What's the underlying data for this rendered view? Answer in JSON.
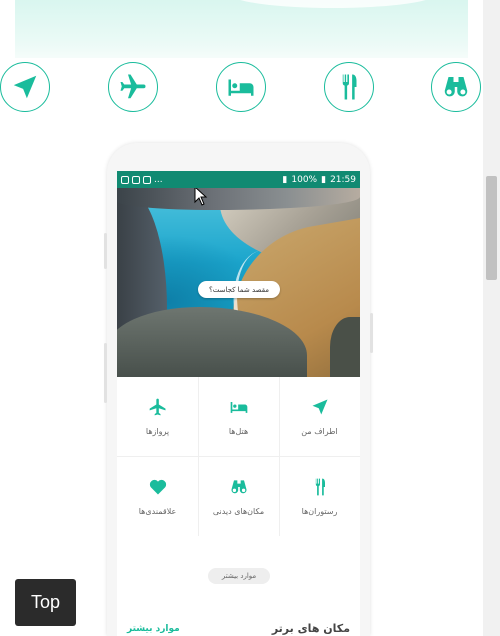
{
  "colors": {
    "accent": "#1abc9c",
    "status_bar": "#118a72",
    "top_button_bg": "#2b2b2b"
  },
  "icon_row": [
    {
      "icon": "location-arrow-icon"
    },
    {
      "icon": "airplane-icon"
    },
    {
      "icon": "bed-icon"
    },
    {
      "icon": "fork-knife-icon"
    },
    {
      "icon": "binoculars-icon"
    }
  ],
  "phone": {
    "status_bar": {
      "left_icons_text": "...",
      "battery": "100%",
      "time": "21:59"
    },
    "hero": {
      "search_placeholder": "مقصد شما کجاست؟"
    },
    "grid": [
      {
        "icon": "airplane-icon",
        "label": "پروازها"
      },
      {
        "icon": "bed-icon",
        "label": "هتل‌ها"
      },
      {
        "icon": "location-arrow-icon",
        "label": "اطراف من"
      },
      {
        "icon": "heart-icon",
        "label": "علاقمندی‌ها"
      },
      {
        "icon": "binoculars-icon",
        "label": "مکان‌های دیدنی"
      },
      {
        "icon": "fork-knife-icon",
        "label": "رستوران‌ها"
      }
    ],
    "more_button": "موارد بیشتر",
    "top_places": {
      "title": "مکان های برتر",
      "link": "موارد بیشتر"
    }
  },
  "top_button": "Top"
}
